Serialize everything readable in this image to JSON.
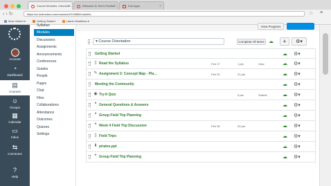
{
  "browser": {
    "tabs": [
      {
        "title": "Course Modules: Introducti...",
        "active": true
      },
      {
        "title": "Welcome to Tom's Portfoli...",
        "active": false
      },
      {
        "title": "Edu Apps",
        "active": false
      }
    ],
    "url": "https://cc.instructure.com/courses/1219860/modules",
    "bookmarks": [
      "Most Visited ▾",
      "Getting Started",
      "Latest Headlines ▾"
    ]
  },
  "global_nav": {
    "items": [
      {
        "label": "Account",
        "icon": "account-icon"
      },
      {
        "label": "Dashboard",
        "icon": "dashboard-icon"
      },
      {
        "label": "Courses",
        "icon": "courses-icon",
        "active": true
      },
      {
        "label": "Groups",
        "icon": "groups-icon"
      },
      {
        "label": "Calendar",
        "icon": "calendar-icon"
      },
      {
        "label": "Inbox",
        "icon": "inbox-icon"
      },
      {
        "label": "Commons",
        "icon": "commons-icon"
      },
      {
        "label": "Help",
        "icon": "help-icon"
      }
    ]
  },
  "course_nav": {
    "items": [
      "Syllabus",
      "Modules",
      "Discussions",
      "Assignments",
      "Announcements",
      "Conferences",
      "Grades",
      "People",
      "Pages",
      "Chat",
      "Files",
      "Collaborations",
      "Attendance",
      "Outcomes",
      "Quizzes",
      "Settings"
    ],
    "active": "Modules"
  },
  "toolbar": {
    "view_progress": "View Progress"
  },
  "module": {
    "title": "Course Orientation",
    "complete_all": "Complete All Items",
    "add_symbol": "+",
    "gear_symbol": "⚙▾"
  },
  "rows": [
    {
      "kind": "header",
      "label": "Getting Started",
      "icon": "",
      "date": "",
      "pts": "",
      "req": ""
    },
    {
      "kind": "item",
      "label": "Read the Syllabus",
      "icon": "page-icon",
      "date": "Feb 17",
      "pts": "1 pts",
      "req": "View"
    },
    {
      "kind": "item",
      "label": "Assignment 2: Concept Map - Pla...",
      "icon": "assignment-icon",
      "date": "Feb 24",
      "pts": "21 pts",
      "req": ""
    },
    {
      "kind": "header",
      "label": "Meeting the Community",
      "icon": "",
      "date": "",
      "pts": "",
      "req": ""
    },
    {
      "kind": "item",
      "label": "Try-It Quiz",
      "icon": "quiz-icon",
      "date": "",
      "pts": "9 pts",
      "req": "Submit"
    },
    {
      "kind": "item",
      "label": "General Questions & Answers",
      "icon": "discussion-icon",
      "date": "",
      "pts": "",
      "req": ""
    },
    {
      "kind": "item",
      "label": "Group Field Trip Planning",
      "icon": "discussion-icon",
      "date": "",
      "pts": "",
      "req": ""
    },
    {
      "kind": "item",
      "label": "Week 4 Field Trip Discussion",
      "icon": "discussion-icon",
      "date": "Feb 26",
      "pts": "20 pts",
      "req": ""
    },
    {
      "kind": "item",
      "label": "Field Trips",
      "icon": "page-icon",
      "date": "",
      "pts": "",
      "req": ""
    },
    {
      "kind": "item",
      "label": "pirates.ppt",
      "icon": "file-icon",
      "date": "",
      "pts": "",
      "req": ""
    },
    {
      "kind": "item",
      "label": "Group Field Trip Planning",
      "icon": "discussion-icon",
      "date": "",
      "pts": "",
      "req": ""
    }
  ],
  "colors": {
    "nav_bg": "#394b58",
    "accent": "#0081bd",
    "published": "#2b8a2b"
  }
}
